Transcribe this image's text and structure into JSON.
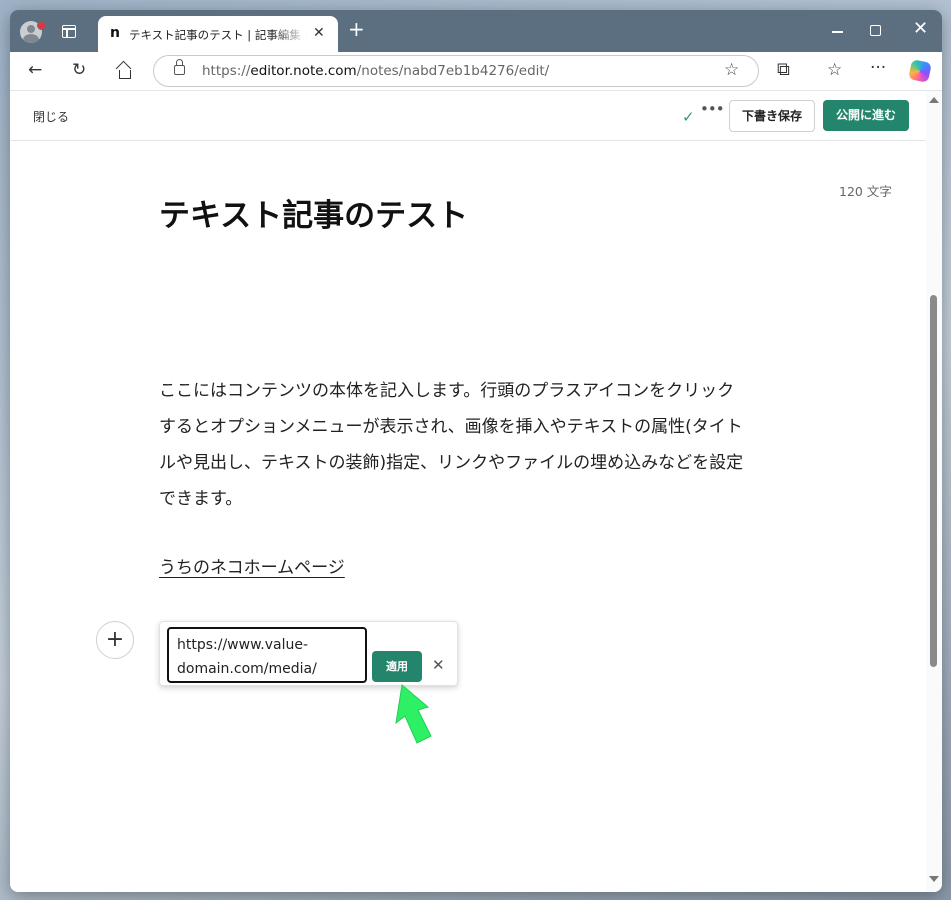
{
  "browser": {
    "tab_title": "テキスト記事のテスト | 記事編集 | note",
    "tab_favicon": "n",
    "url_scheme": "https://",
    "url_host": "editor.note.com",
    "url_path": "/notes/nabd7eb1b4276/edit/",
    "icons": [
      "profile-icon",
      "tab-actions-icon",
      "close-icon",
      "new-tab-icon",
      "minimize-icon",
      "maximize-icon",
      "back-icon",
      "refresh-icon",
      "home-icon",
      "lock-icon",
      "favorite-star-icon",
      "extensions-icon",
      "favorites-icon",
      "more-icon",
      "copilot-icon"
    ]
  },
  "editor": {
    "close_label": "閉じる",
    "draft_save_label": "下書き保存",
    "publish_label": "公開に進む",
    "char_count": "120 文字",
    "title": "テキスト記事のテスト",
    "body_lines": [
      "ここにはコンテンツの本体を記入します。行頭のプラスアイコンをクリック",
      "するとオプションメニューが表示され、画像を挿入やテキストの属性(タイト",
      "ルや見出し、テキストの装飾)指定、リンクやファイルの埋め込みなどを設定",
      "できます。"
    ],
    "link_text": "うちのネコホームページ",
    "link_popup": {
      "url_value": "https://www.value-domain.com/media/",
      "apply_label": "適用"
    }
  },
  "colors": {
    "brand_green": "#23856b",
    "highlight_arrow": "#2ef064"
  }
}
